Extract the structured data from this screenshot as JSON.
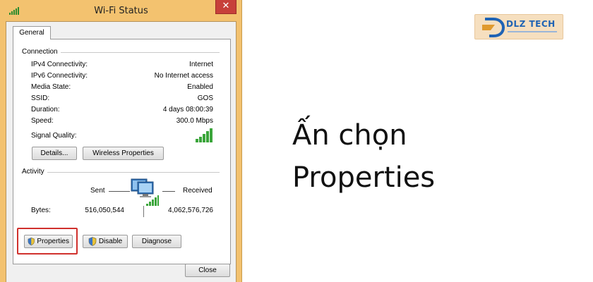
{
  "window": {
    "title": "Wi-Fi Status",
    "close_glyph": "✕",
    "title_icon": "wifi-signal-icon"
  },
  "tabs": [
    {
      "label": "General",
      "selected": true
    }
  ],
  "connection": {
    "header": "Connection",
    "rows": [
      {
        "label": "IPv4 Connectivity:",
        "value": "Internet"
      },
      {
        "label": "IPv6 Connectivity:",
        "value": "No Internet access"
      },
      {
        "label": "Media State:",
        "value": "Enabled"
      },
      {
        "label": "SSID:",
        "value": "GOS"
      },
      {
        "label": "Duration:",
        "value": "4 days 08:00:39"
      },
      {
        "label": "Speed:",
        "value": "300.0 Mbps"
      }
    ],
    "signal_label": "Signal Quality:",
    "signal_bars": 5,
    "details_button": "Details...",
    "wireless_button": "Wireless Properties"
  },
  "activity": {
    "header": "Activity",
    "sent_label": "Sent",
    "received_label": "Received",
    "bytes_label": "Bytes:",
    "bytes_sent": "516,050,544",
    "bytes_received": "4,062,576,726"
  },
  "buttons": {
    "properties": "Properties",
    "disable": "Disable",
    "diagnose": "Diagnose",
    "close": "Close"
  },
  "caption": {
    "line1": "Ấn chọn",
    "line2": "Properties"
  },
  "logo": {
    "text": "DLZ TECH"
  },
  "colors": {
    "window_frame": "#f3c26f",
    "close_button": "#c7403a",
    "highlight": "#d0312d",
    "signal_green": "#3aa53a",
    "logo_blue": "#1f63b4"
  }
}
